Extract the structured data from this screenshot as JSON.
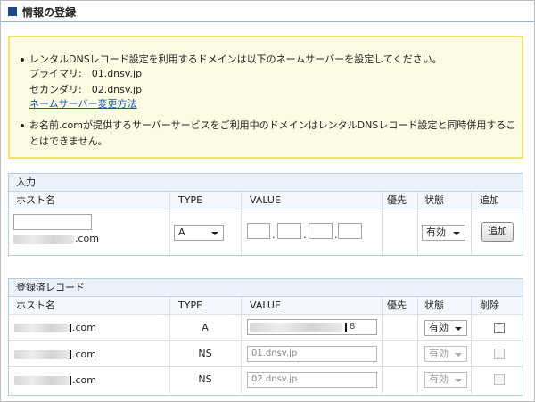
{
  "page": {
    "title": "情報の登録"
  },
  "notice": {
    "bullet1": "レンタルDNSレコード設定を利用するドメインは以下のネームサーバーを設定してください。",
    "primary": "プライマリ:　01.dnsv.jp",
    "secondary": "セカンダリ:　02.dnsv.jp",
    "link": "ネームサーバー変更方法",
    "bullet2_line1": "お名前.comが提供するサーバーサービスをご利用中のドメインはレンタルDNSレコード設定と同時併用するこ",
    "bullet2_line2": "とはできません。"
  },
  "input_panel": {
    "title": "入力",
    "headers": {
      "host": "ホスト名",
      "type": "TYPE",
      "value": "VALUE",
      "priority": "優先",
      "status": "状態",
      "add": "追加"
    },
    "domain_suffix": ".com",
    "type_selected": "A",
    "status_selected": "有効",
    "dots": [
      "."
    ],
    "add_button": "追加"
  },
  "records_panel": {
    "title": "登録済レコード",
    "headers": {
      "host": "ホスト名",
      "type": "TYPE",
      "value": "VALUE",
      "priority": "優先",
      "status": "状態",
      "delete": "削除"
    },
    "rows": [
      {
        "suffix": ".com",
        "type": "A",
        "value": "8",
        "status": "有効"
      },
      {
        "suffix": ".com",
        "type": "NS",
        "value": "01.dnsv.jp",
        "status": "有効"
      },
      {
        "suffix": ".com",
        "type": "NS",
        "value": "02.dnsv.jp",
        "status": "有効"
      }
    ]
  },
  "colors": {
    "accent": "#1d4a8c",
    "notice_bg": "#fcfce4",
    "notice_border": "#f0e26a",
    "link": "#1a56b8",
    "panel_header": "#eaf1f9"
  },
  "icons": [
    "square-bullet-icon",
    "chevron-down-icon",
    "checkbox-icon"
  ]
}
